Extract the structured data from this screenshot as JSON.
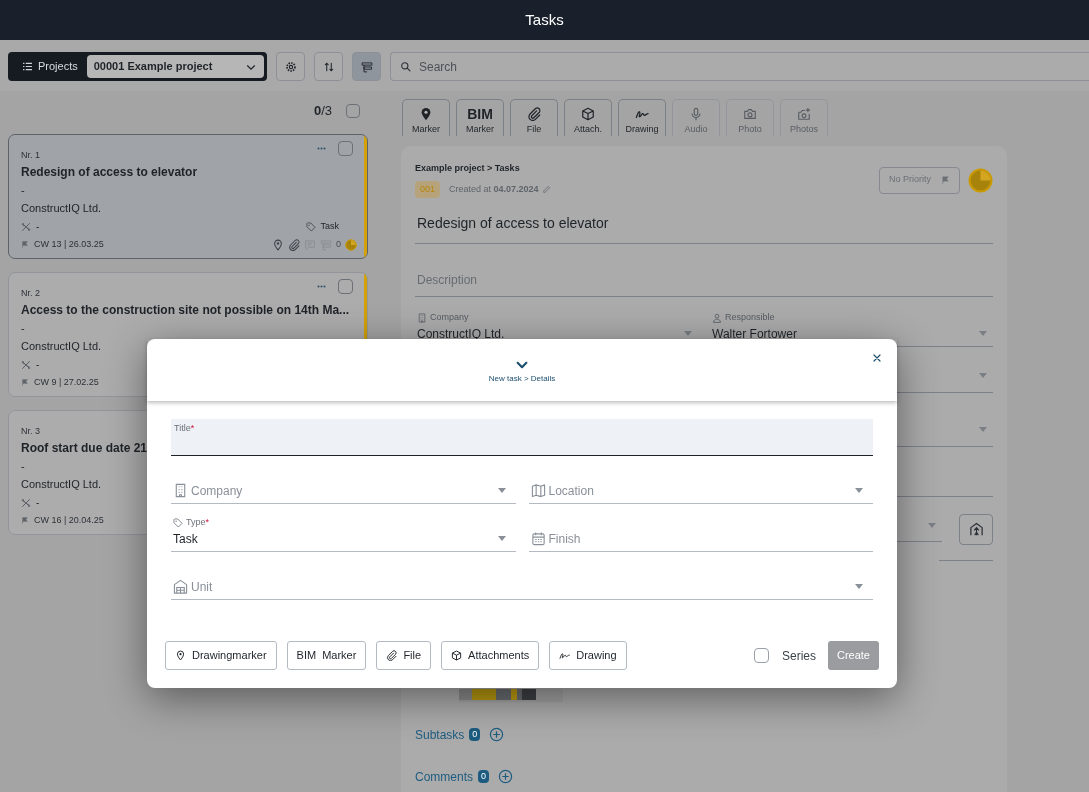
{
  "app_bar": {
    "title": "Tasks"
  },
  "toolbar": {
    "projects_label": "Projects",
    "project": "00001 Example project",
    "view_buttons": [
      {
        "selected": false
      },
      {
        "selected": false
      },
      {
        "selected": true
      }
    ],
    "search_placeholder": "Search"
  },
  "task_list": {
    "count": "**0**/3",
    "all_checked": false,
    "tasks": [
      {
        "number": "Nr. 1",
        "title": "Redesign of access to elevator",
        "description": "-",
        "company": "ConstructIQ Ltd.",
        "location": "-",
        "tag": "Task",
        "due": "CW 13 | 26.03.25",
        "comment_count": "0",
        "selected": true,
        "checked": false,
        "color": "#d4a106"
      },
      {
        "number": "Nr. 2",
        "title": "Access to the construction site not possible on 14th Ma...",
        "description": "-",
        "company": "ConstructIQ Ltd.",
        "location": "-",
        "due": "CW 9 | 27.02.25",
        "selected": false,
        "checked": false,
        "color": "#d4a106"
      },
      {
        "number": "Nr. 3",
        "title": "Roof start due date 21",
        "description": "-",
        "company": "ConstructIQ Ltd.",
        "location": "-",
        "due": "CW 16 | 20.04.25",
        "selected": false
      }
    ]
  },
  "detail": {
    "attachment_buttons": [
      {
        "label": "Marker",
        "disabled": false
      },
      {
        "label": "Marker",
        "icon_text": "BIM",
        "disabled": false
      },
      {
        "label": "File",
        "disabled": false
      },
      {
        "label": "Attach.",
        "disabled": false
      },
      {
        "label": "Drawing",
        "disabled": false
      },
      {
        "label": "Audio",
        "disabled": true
      },
      {
        "label": "Photo",
        "disabled": true
      },
      {
        "label": "Photos",
        "disabled": true
      }
    ],
    "breadcrumb": "Example project > Tasks",
    "number": "001",
    "created": "Created at **04.07.2024**",
    "priority": "No Priority",
    "title": "Redesign of access to elevator",
    "description_placeholder": "Description",
    "fields": [
      {
        "label": "Company",
        "value": "ConstructIQ Ltd."
      },
      {
        "label": "Responsible",
        "value": "Walter Fortower"
      }
    ],
    "subtasks": {
      "label": "Subtasks",
      "count": "0"
    },
    "comments": {
      "label": "Comments",
      "count": "0"
    }
  },
  "modal": {
    "breadcrumb": "New task > Details",
    "required_mark": "*",
    "rows": [
      {
        "fields": [
          {
            "kind": "text",
            "label": "Title",
            "required": true,
            "focused": true
          }
        ]
      },
      {
        "fields": [
          {
            "kind": "select",
            "label": "Company",
            "required": false,
            "focused": false
          },
          {
            "kind": "select",
            "label": "Location",
            "required": false,
            "focused": false
          }
        ]
      },
      {
        "fields": [
          {
            "kind": "select",
            "label": "Type",
            "required": true,
            "focused": false,
            "value": "Task"
          },
          {
            "kind": "date",
            "label": "Finish",
            "required": false,
            "focused": false
          }
        ]
      },
      {
        "fields": [
          {
            "kind": "select",
            "label": "Unit",
            "required": false,
            "focused": false
          }
        ]
      }
    ],
    "attach_buttons": [
      {
        "label": "Drawingmarker"
      },
      {
        "label": "Marker",
        "icon_text": "BIM"
      },
      {
        "label": "File"
      },
      {
        "label": "Attachments"
      },
      {
        "label": "Drawing"
      }
    ],
    "series": {
      "label": "Series",
      "checked": false
    },
    "create": {
      "label": "Create",
      "disabled": true
    }
  }
}
